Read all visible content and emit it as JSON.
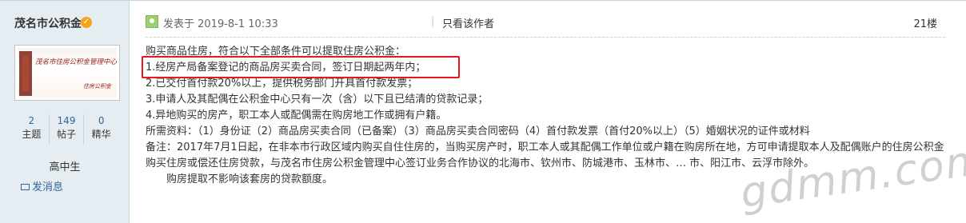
{
  "author": {
    "name": "茂名市公积金",
    "avatar_text": "茂名市住房公积金管理中心",
    "avatar_subtext": "住房公积金",
    "stats": [
      {
        "num": "2",
        "label": "主题"
      },
      {
        "num": "149",
        "label": "帖子"
      },
      {
        "num": "0",
        "label": "精华"
      }
    ],
    "rank": "高中生",
    "pm_label": "发消息"
  },
  "post": {
    "posted_at": "发表于 2019-8-1 10:33",
    "separator": "|",
    "only_author": "只看该作者",
    "floor": "21楼",
    "lines": [
      "购买商品住房，符合以下全部条件可以提取住房公积金：",
      "1.经房产局备案登记的商品房买卖合同，签订日期起两年内；",
      "2.已交付首付款20%以上，提供税务部门开具首付款发票；",
      "3.申请人及其配偶在公积金中心只有一次（含）以下且已结清的贷款记录；",
      "4.异地购买的房产，职工本人或配偶需在购房地工作或拥有户籍。",
      "所需资料：（1）身份证（2）商品房买卖合同（已备案）（3）商品房买卖合同密码（4）首付款发票（首付20%以上）（5）婚姻状况的证件或材料",
      "备注：2017年7月1日起，在非本市行政区域内购买自住住房的，当购买房产时，职工本人或其配偶工作单位或户籍在购房所在地，方可申请提取本人及配偶账户的住房公积金购买住房或偿还住房贷款，与茂名市住房公积金管理中心签订业务合作协议的北海市、钦州市、防城港市、玉林市、… 市、阳江市、云浮市除外。",
      "　　购房提取不影响该套房的贷款额度。"
    ]
  },
  "watermark": "gdmm.com"
}
